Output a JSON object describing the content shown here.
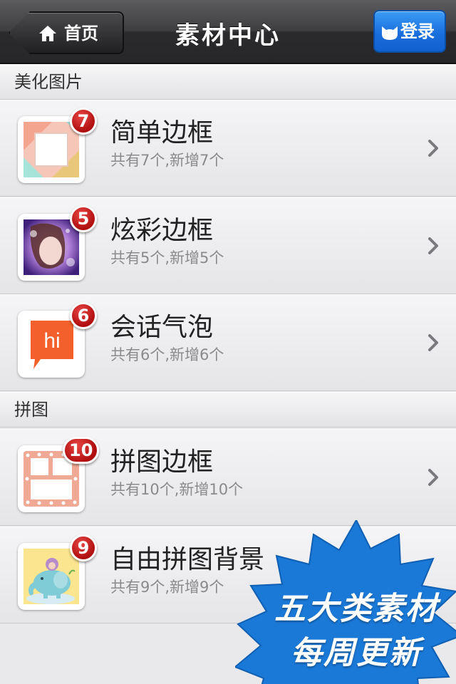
{
  "nav": {
    "back_label": "首页",
    "back_icon": "home-icon",
    "title": "素材中心",
    "login_label": "登录",
    "login_icon": "cat-face-icon",
    "login_color": "#1a6fdc"
  },
  "sections": [
    {
      "header": "美化图片",
      "items": [
        {
          "title": "简单边框",
          "subtitle": "共有7个,新增7个",
          "badge": "7",
          "icon": "simple-frame-thumbnail"
        },
        {
          "title": "炫彩边框",
          "subtitle": "共有5个,新增5个",
          "badge": "5",
          "icon": "colorful-frame-thumbnail"
        },
        {
          "title": "会话气泡",
          "subtitle": "共有6个,新增6个",
          "badge": "6",
          "icon": "speech-bubble-thumbnail",
          "icon_text": "hi"
        }
      ]
    },
    {
      "header": "拼图",
      "items": [
        {
          "title": "拼图边框",
          "subtitle": "共有10个,新增10个",
          "badge": "10",
          "icon": "collage-frame-thumbnail"
        },
        {
          "title": "自由拼图背景",
          "subtitle": "共有9个,新增9个",
          "badge": "9",
          "icon": "elephant-background-thumbnail"
        }
      ]
    }
  ],
  "promo": {
    "line1": "五大类素材",
    "line2": "每周更新",
    "color": "#1a78d6"
  },
  "colors": {
    "badge_red": "#c41818",
    "accent_blue": "#1a6fdc"
  }
}
